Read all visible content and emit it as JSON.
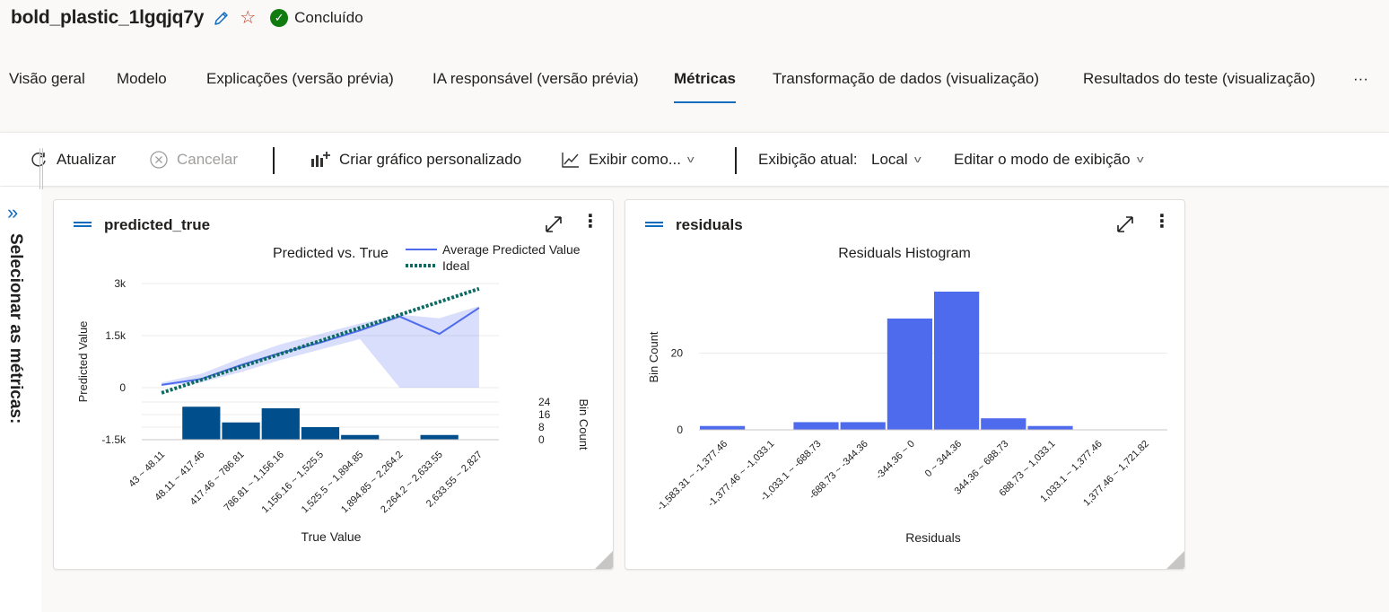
{
  "run": {
    "title": "bold_plastic_1lgqjq7y",
    "status": "Concluído",
    "icons": [
      "edit-icon",
      "star-icon",
      "check-circle-icon"
    ],
    "colors": {
      "accent": "#0f6cbd",
      "status_ok": "#107c10",
      "favorite": "#c23b22"
    }
  },
  "tabs": [
    {
      "label": "Visão geral"
    },
    {
      "label": "Modelo"
    },
    {
      "label": "Explicações (versão prévia)"
    },
    {
      "label": "IA responsável (versão prévia)"
    },
    {
      "label": "Métricas",
      "active": true
    },
    {
      "label": "Transformação de dados (visualização)"
    },
    {
      "label": "Resultados do teste (visualização)"
    },
    {
      "label": "···"
    }
  ],
  "toolbar": {
    "refresh": "Atualizar",
    "cancel": "Cancelar",
    "create_chart": "Criar gráfico personalizado",
    "view_as": "Exibir como...",
    "current_view_label": "Exibição atual:",
    "current_view_value": "Local",
    "edit_view_mode": "Editar o modo de exibição"
  },
  "sidebar": {
    "label": "Selecionar as métricas:"
  },
  "cards": [
    {
      "title": "predicted_true"
    },
    {
      "title": "residuals"
    }
  ],
  "chart_data": [
    {
      "type": "line",
      "title": "Predicted vs. True",
      "xlabel": "True Value",
      "ylabel": "Predicted Value",
      "y2label": "Bin Count",
      "ylim": [
        -1500,
        3000
      ],
      "yticks": [
        "3k",
        "1.5k",
        "0",
        "-1.5k"
      ],
      "y2ticks": [
        "24",
        "16",
        "8",
        "0"
      ],
      "y2lim": [
        0,
        24
      ],
      "legend_position": "top-right",
      "categories": [
        "43 ~ 48.11",
        "48.11 ~ 417.46",
        "417.46 ~ 786.81",
        "786.81 ~ 1,156.16",
        "1,156.16 ~ 1,525.5",
        "1,525.5 ~ 1,894.85",
        "1,894.85 ~ 2,264.2",
        "2,264.2 ~ 2,633.55",
        "2,633.55 ~ 2,827"
      ],
      "series": [
        {
          "name": "Average Predicted Value",
          "kind": "line",
          "color": "#4f6bed",
          "x": [
            0,
            1,
            2,
            3,
            4,
            5,
            6,
            7,
            8
          ],
          "values": [
            80,
            250,
            650,
            1000,
            1300,
            1650,
            2050,
            1550,
            2300
          ]
        },
        {
          "name": "Ideal",
          "kind": "dotted-line",
          "color": "#0b6a61",
          "x": [
            0,
            8
          ],
          "values": [
            -150,
            2850
          ]
        }
      ],
      "band": {
        "upper": [
          150,
          400,
          850,
          1250,
          1550,
          1850,
          2100,
          2000,
          2350
        ],
        "lower": [
          50,
          150,
          450,
          800,
          1100,
          1400,
          0,
          0,
          0
        ]
      },
      "bin_counts": [
        0,
        21,
        11,
        20,
        8,
        3,
        0,
        3,
        0
      ],
      "bar_color": "#004e8c",
      "grid": true
    },
    {
      "type": "bar",
      "title": "Residuals Histogram",
      "xlabel": "Residuals",
      "ylabel": "Bin Count",
      "ylim": [
        0,
        36
      ],
      "yticks": [
        "20",
        "0"
      ],
      "categories": [
        "-1,583.31 ~ -1,377.46",
        "-1,377.46 ~ -1,033.1",
        "-1,033.1 ~ -688.73",
        "-688.73 ~ -344.36",
        "-344.36 ~ 0",
        "0 ~ 344.36",
        "344.36 ~ 688.73",
        "688.73 ~ 1,033.1",
        "1,033.1 ~ 1,377.46",
        "1,377.46 ~ 1,721.82"
      ],
      "values": [
        1,
        0,
        2,
        2,
        29,
        36,
        3,
        1,
        0,
        0
      ],
      "bar_color": "#4f6bed",
      "grid": true
    }
  ]
}
